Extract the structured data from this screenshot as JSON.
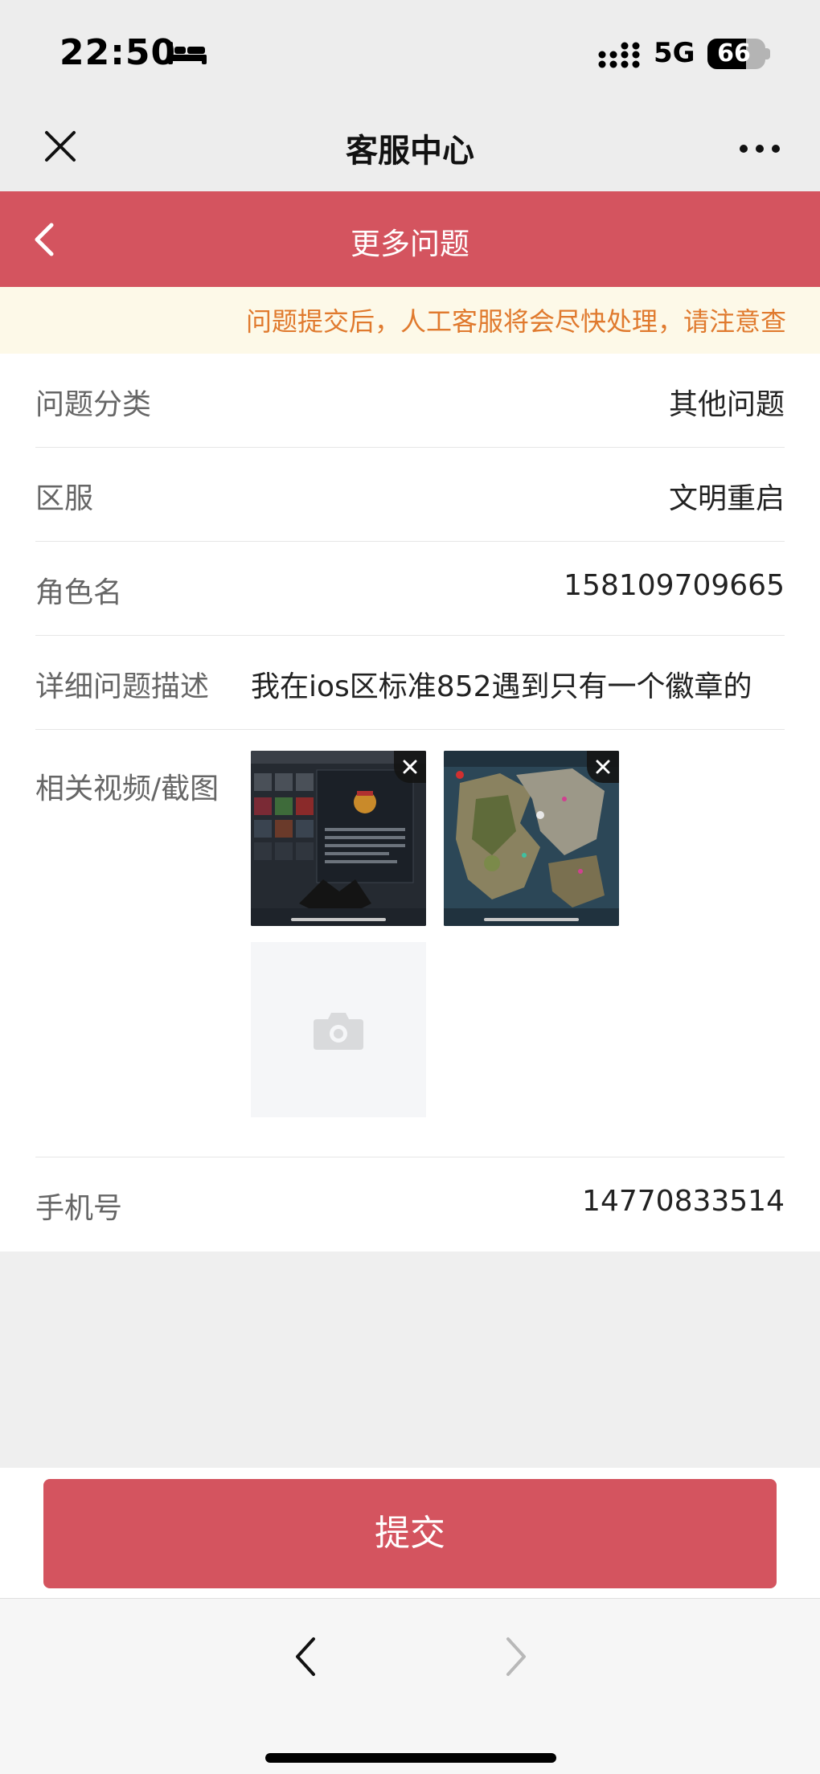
{
  "status_bar": {
    "time": "22:50",
    "network": "5G",
    "battery_percent": 66,
    "battery_label": "66"
  },
  "wechat_bar": {
    "title": "客服中心"
  },
  "page_header": {
    "title": "更多问题"
  },
  "notice": {
    "text": "问题提交后，人工客服将会尽快处理，请注意查"
  },
  "form": {
    "category": {
      "label": "问题分类",
      "value": "其他问题"
    },
    "server": {
      "label": "区服",
      "value": "文明重启"
    },
    "role": {
      "label": "角色名",
      "value": "158109709665"
    },
    "description": {
      "label": "详细问题描述",
      "value": "我在ios区标准852遇到只有一个徽章的"
    },
    "media": {
      "label": "相关视频/截图",
      "thumbnails": [
        "screenshot-inventory",
        "screenshot-map"
      ]
    },
    "phone": {
      "label": "手机号",
      "value": "14770833514"
    }
  },
  "footer": {
    "submit_label": "提交"
  },
  "colors": {
    "accent": "#d4545f",
    "notice_text": "#e07a2e",
    "notice_bg": "#fdf9e8"
  }
}
